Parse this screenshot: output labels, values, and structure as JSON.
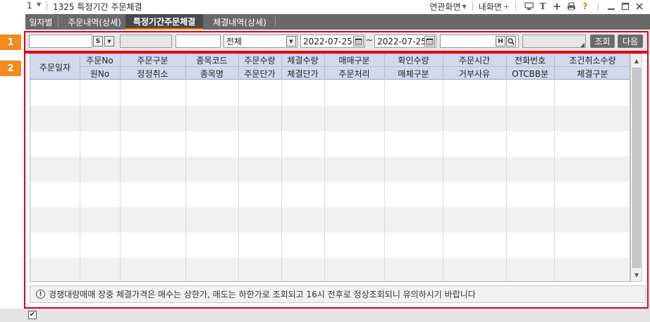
{
  "titlebar": {
    "window_no": "1",
    "title": "1325 특정기간 주문체결",
    "related_screen": "연관화면",
    "my_screen": "내화면",
    "icons": [
      "monitor-icon",
      "text-icon",
      "plus-icon",
      "print-icon",
      "help-icon",
      "minimize-icon",
      "maximize-icon",
      "close-icon"
    ],
    "help_glyph": "?"
  },
  "tabs": [
    {
      "label": "일자별"
    },
    {
      "label": "주문내역(상세)"
    },
    {
      "label": "특정기간주문체결",
      "active": true
    },
    {
      "label": "체결내역(상세)"
    }
  ],
  "badges": [
    "1",
    "2"
  ],
  "filters": {
    "account_btn": "S",
    "order_type": "전체",
    "date_from": "2022-07-25",
    "tilde": "~",
    "date_to": "2022-07-25",
    "code_btn": "H",
    "query_button": "조회",
    "next_button": "다음"
  },
  "grid": {
    "columns": [
      {
        "top": "주문일자",
        "bottom": ""
      },
      {
        "top": "주문No",
        "bottom": "원No"
      },
      {
        "top": "주문구분",
        "bottom": "정정취소"
      },
      {
        "top": "종목코드",
        "bottom": "종목명"
      },
      {
        "top": "주문수량",
        "bottom": "주문단가"
      },
      {
        "top": "체결수량",
        "bottom": "체결단가"
      },
      {
        "top": "매매구분",
        "bottom": "주문처리"
      },
      {
        "top": "확인수량",
        "bottom": "매체구분"
      },
      {
        "top": "주문시간",
        "bottom": "거부사유"
      },
      {
        "top": "전화번호",
        "bottom": "OTCBB분"
      },
      {
        "top": "조건취소수량",
        "bottom": "체결구분"
      }
    ],
    "rows": []
  },
  "notice": "경쟁대량매매 장중 체결가격은 매수는 상한가, 매도는 하한가로 조회되고 16시 전후로 정상조회되니 유의하시기 바랍니다",
  "colors": {
    "accent": "#f5891f",
    "frame": "#e0001b",
    "tabbar": "#6a6a6a",
    "header": "#d3d8ee"
  }
}
